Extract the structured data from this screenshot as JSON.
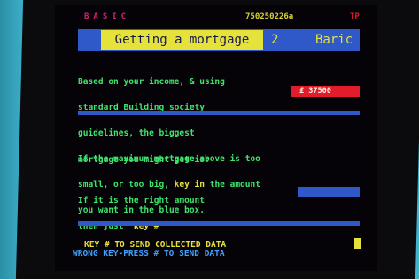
{
  "header": {
    "brand": "BASIC",
    "page_code": "750250226a",
    "flag": "TP"
  },
  "title_bar": {
    "title": "Getting a mortgage",
    "number": "2",
    "right_label": "Baric"
  },
  "intro": {
    "line1": "Based on your income, & using",
    "line2": "standard Building society",
    "line3": "guidelines, the biggest",
    "line4": "mortgage you might get is:"
  },
  "mortgage_amount": "£ 37500",
  "adjust": {
    "line1": "If the maximum mortgage above is too",
    "line2_a": "small, or too big, ",
    "line2_key": "key in",
    "line2_b": " the amount",
    "line3": "you want in the blue box."
  },
  "confirm": {
    "line1": "If it is the right amount",
    "line2_a": "then just  ",
    "line2_key": "key #"
  },
  "footer": {
    "line1": "KEY # TO SEND COLLECTED DATA",
    "line2": "WRONG KEY-PRESS # TO SEND DATA"
  },
  "colors": {
    "background": "#3fb3cc",
    "screen": "#050308",
    "text_green": "#3ee56a",
    "text_yellow": "#e5e23c",
    "bar_blue": "#2f59c8",
    "amount_red": "#e21c2a",
    "footer_blue": "#3fa0ff"
  }
}
